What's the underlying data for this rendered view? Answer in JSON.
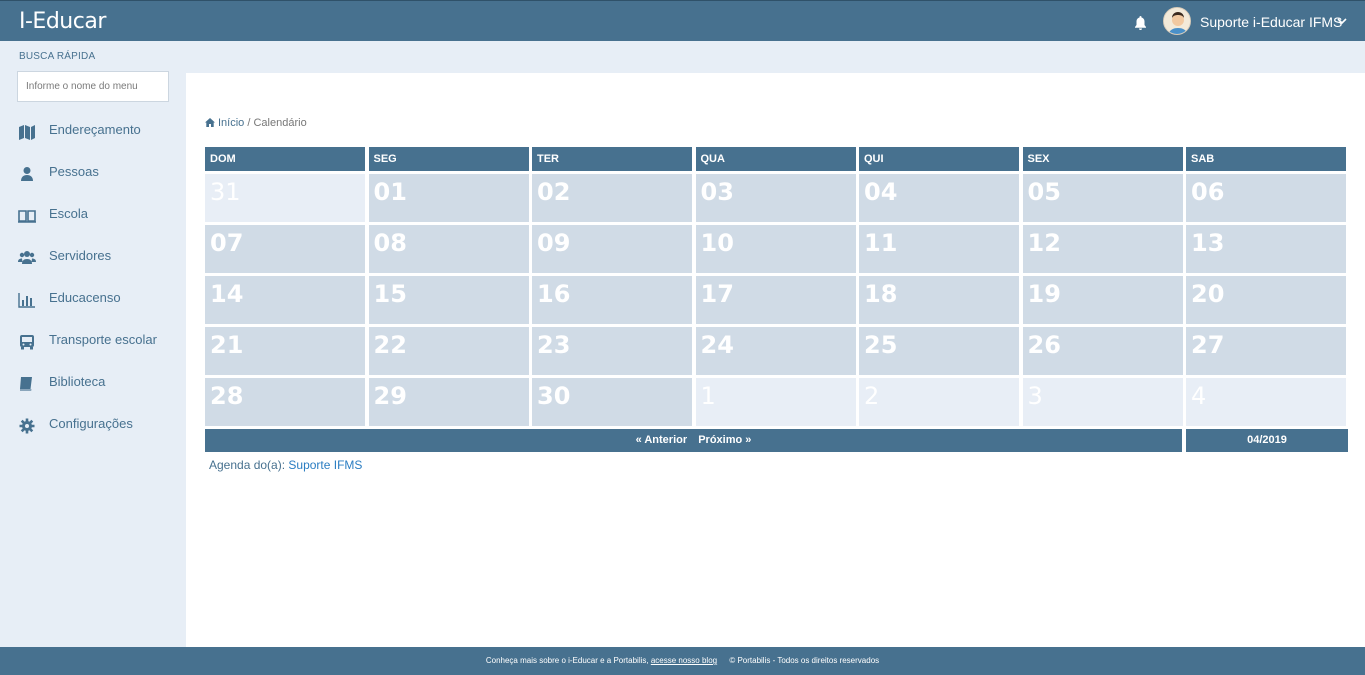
{
  "header": {
    "brand": "I-Educar",
    "user_name": "Suporte i-Educar IFMS"
  },
  "sidebar": {
    "quick_title": "BUSCA RÁPIDA",
    "search_placeholder": "Informe o nome do menu",
    "items": [
      {
        "label": "Endereçamento",
        "icon": "map-icon"
      },
      {
        "label": "Pessoas",
        "icon": "user-icon"
      },
      {
        "label": "Escola",
        "icon": "book-open-icon"
      },
      {
        "label": "Servidores",
        "icon": "users-icon"
      },
      {
        "label": "Educacenso",
        "icon": "bar-chart-icon"
      },
      {
        "label": "Transporte escolar",
        "icon": "bus-icon"
      },
      {
        "label": "Biblioteca",
        "icon": "book-icon"
      },
      {
        "label": "Configurações",
        "icon": "gear-icon"
      }
    ]
  },
  "breadcrumb": {
    "home": "Início",
    "separator": "/",
    "current": "Calendário"
  },
  "calendar": {
    "weekdays": [
      "DOM",
      "SEG",
      "TER",
      "QUA",
      "QUI",
      "SEX",
      "SAB"
    ],
    "weeks": [
      [
        {
          "d": "31",
          "out": true
        },
        {
          "d": "01"
        },
        {
          "d": "02"
        },
        {
          "d": "03"
        },
        {
          "d": "04"
        },
        {
          "d": "05"
        },
        {
          "d": "06"
        }
      ],
      [
        {
          "d": "07"
        },
        {
          "d": "08"
        },
        {
          "d": "09"
        },
        {
          "d": "10"
        },
        {
          "d": "11"
        },
        {
          "d": "12"
        },
        {
          "d": "13"
        }
      ],
      [
        {
          "d": "14"
        },
        {
          "d": "15"
        },
        {
          "d": "16"
        },
        {
          "d": "17"
        },
        {
          "d": "18"
        },
        {
          "d": "19"
        },
        {
          "d": "20"
        }
      ],
      [
        {
          "d": "21"
        },
        {
          "d": "22"
        },
        {
          "d": "23"
        },
        {
          "d": "24"
        },
        {
          "d": "25"
        },
        {
          "d": "26"
        },
        {
          "d": "27"
        }
      ],
      [
        {
          "d": "28"
        },
        {
          "d": "29"
        },
        {
          "d": "30"
        },
        {
          "d": "1",
          "out": true
        },
        {
          "d": "2",
          "out": true
        },
        {
          "d": "3",
          "out": true
        },
        {
          "d": "4",
          "out": true
        }
      ]
    ],
    "prev_label": "« Anterior",
    "next_label": "Próximo »",
    "month": "04/2019"
  },
  "agenda": {
    "prefix": "Agenda do(a):",
    "owner": "Suporte IFMS"
  },
  "footer": {
    "text": "Conheça mais sobre o i-Educar e a Portabilis,",
    "link": "acesse nosso blog",
    "copyright": "© Portabilis - Todos os direitos reservados"
  },
  "colors": {
    "primary": "#47718f",
    "day_cell": "#d0dbe6",
    "day_cell_out": "#e8eef6",
    "link": "#2a7dc2"
  }
}
